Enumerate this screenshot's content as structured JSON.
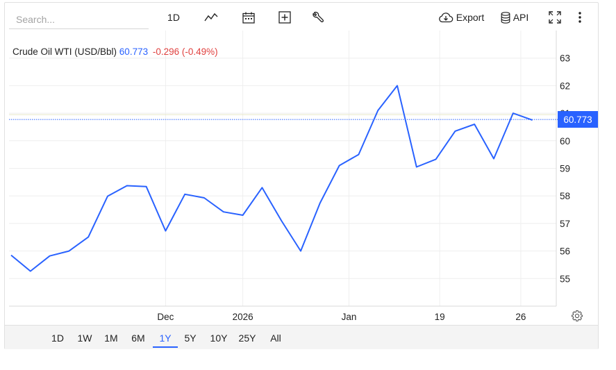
{
  "toolbar": {
    "search_placeholder": "Search...",
    "interval_label": "1D",
    "chart_style_icon": "line-chart-icon",
    "calendar_icon": "calendar-icon",
    "add_icon": "plus-square-icon",
    "tools_icon": "wrench-icon",
    "export_label": "Export",
    "api_label": "API",
    "fullscreen_icon": "fullscreen-icon",
    "more_icon": "more-vertical-icon"
  },
  "legend": {
    "symbol": "Crude Oil WTI (USD/Bbl)",
    "last": "60.773",
    "change": "-0.296 (-0.49%)"
  },
  "price_tag": "60.773",
  "range_buttons": [
    "1D",
    "1W",
    "1M",
    "6M",
    "1Y",
    "5Y",
    "10Y",
    "25Y",
    "All"
  ],
  "active_range": "1Y",
  "settings_icon": "gear-icon",
  "colors": {
    "line": "#2962ff",
    "negative": "#e0413f",
    "grid": "#eeeeee"
  },
  "chart_data": {
    "type": "line",
    "series": [
      {
        "values": [
          55.85,
          55.27,
          55.82,
          56.0,
          56.51,
          57.99,
          58.37,
          58.34,
          56.73,
          58.06,
          57.93,
          57.42,
          57.3,
          58.3,
          57.1,
          56.0,
          57.74,
          59.1,
          59.5,
          61.1,
          62.0,
          59.05,
          59.33,
          60.35,
          60.6,
          59.35,
          61.0,
          60.75
        ]
      }
    ],
    "ylim": [
      54.0,
      64.0
    ],
    "y_ticks": [
      55,
      56,
      57,
      58,
      59,
      60,
      61,
      62,
      63
    ],
    "x_tick_labels": [
      {
        "index": 8.0,
        "label": "Dec"
      },
      {
        "index": 12.0,
        "label": "2026"
      },
      {
        "index": 17.5,
        "label": "Jan"
      },
      {
        "index": 22.2,
        "label": "19"
      },
      {
        "index": 26.4,
        "label": "26"
      }
    ],
    "last_value": 60.773,
    "previous_close": 60.95,
    "grid": true,
    "axis_side": "right"
  }
}
